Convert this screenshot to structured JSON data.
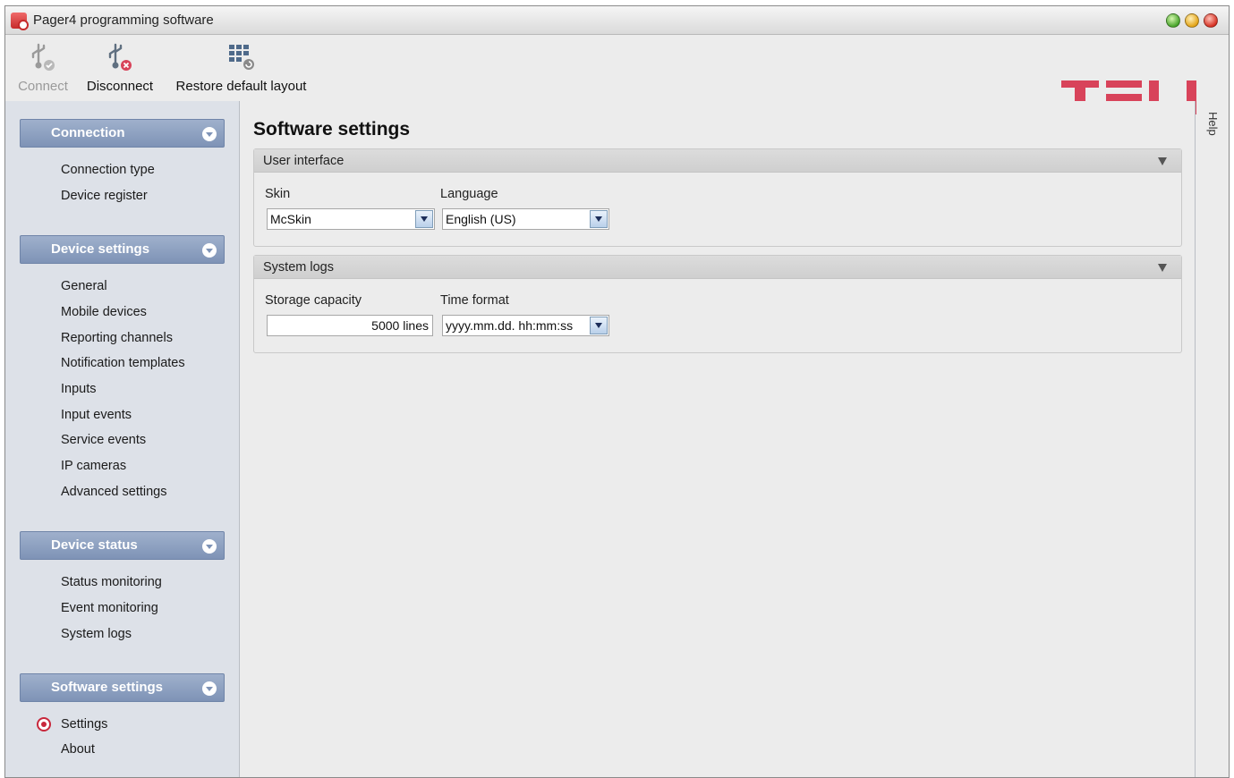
{
  "window": {
    "title": "Pager4 programming software",
    "controls": [
      "maximize",
      "minimize",
      "close"
    ]
  },
  "toolbar": {
    "connect_label": "Connect",
    "disconnect_label": "Disconnect",
    "restore_label": "Restore default layout"
  },
  "brand": {
    "logo_text": "TELL",
    "logo_color": "#d8435a"
  },
  "sidebar": {
    "sections": [
      {
        "label": "Connection",
        "items": [
          "Connection type",
          "Device register"
        ]
      },
      {
        "label": "Device settings",
        "items": [
          "General",
          "Mobile devices",
          "Reporting channels",
          "Notification templates",
          "Inputs",
          "Input events",
          "Service events",
          "IP cameras",
          "Advanced settings"
        ]
      },
      {
        "label": "Device status",
        "items": [
          "Status monitoring",
          "Event monitoring",
          "System logs"
        ]
      },
      {
        "label": "Software settings",
        "items": [
          "Settings",
          "About"
        ]
      }
    ],
    "selected": "Settings"
  },
  "main": {
    "title": "Software settings",
    "user_interface": {
      "title": "User interface",
      "skin_label": "Skin",
      "skin_value": "McSkin",
      "language_label": "Language",
      "language_value": "English (US)"
    },
    "system_logs": {
      "title": "System logs",
      "storage_label": "Storage capacity",
      "storage_value": "5000 lines",
      "time_format_label": "Time format",
      "time_format_value": "yyyy.mm.dd. hh:mm:ss"
    }
  },
  "help": {
    "label": "Help"
  },
  "colors": {
    "accent": "#7e93b6",
    "selected_radio": "#c8283c",
    "sidebar_bg": "#dde1e8"
  }
}
